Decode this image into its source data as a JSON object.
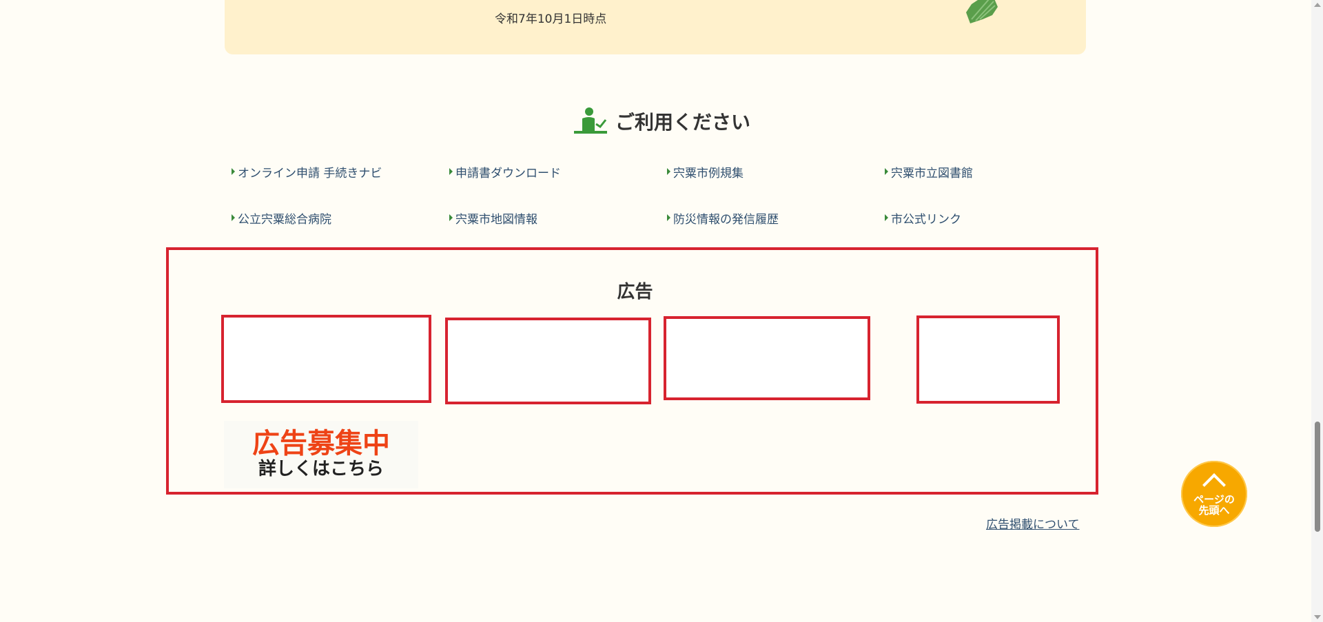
{
  "population": {
    "date_label": "令和7年10月1日時点"
  },
  "use_section": {
    "title": "ご利用ください",
    "links": [
      {
        "label": "オンライン申請 手続きナビ"
      },
      {
        "label": "申請書ダウンロード"
      },
      {
        "label": "宍粟市例規集"
      },
      {
        "label": "宍粟市立図書館"
      },
      {
        "label": "公立宍粟総合病院"
      },
      {
        "label": "宍粟市地図情報"
      },
      {
        "label": "防災情報の発信履歴"
      },
      {
        "label": "市公式リンク"
      }
    ]
  },
  "ads": {
    "title": "広告",
    "recruit_main": "広告募集中",
    "recruit_sub": "詳しくはこちら",
    "about_link": "広告掲載について"
  },
  "back_to_top": {
    "label": "ページの先頭へ"
  },
  "colors": {
    "background": "#fffdf6",
    "card": "#fff1cc",
    "ad_border": "#d7232f",
    "link": "#2f4f6f",
    "accent_green": "#3a8a3a",
    "back_top": "#f7a800",
    "recruit_text": "#ee4316"
  }
}
